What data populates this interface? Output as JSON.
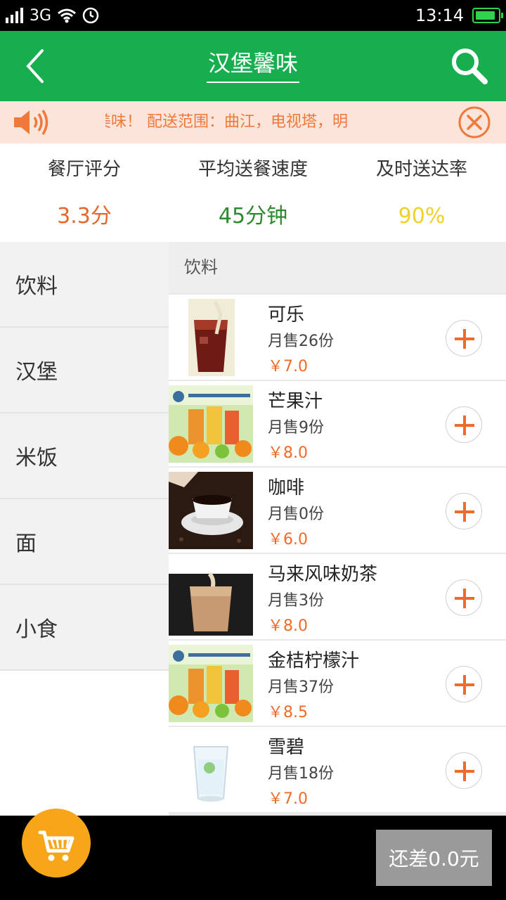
{
  "status_bar": {
    "network": "3G",
    "time": "13:14",
    "battery_level": 0.85
  },
  "header": {
    "title": "汉堡馨味",
    "back_icon": "chevron-left-icon",
    "search_icon": "search-icon"
  },
  "notice": {
    "text": "美味！ 配送范围：曲江，电视塔，明",
    "speaker_icon": "speaker-icon",
    "close_icon": "close-circle-icon"
  },
  "stats": [
    {
      "label": "餐厅评分",
      "value": "3.3分",
      "color": "#e8662a"
    },
    {
      "label": "平均送餐速度",
      "value": "45分钟",
      "color": "#2d8a2d"
    },
    {
      "label": "及时送达率",
      "value": "90%",
      "color": "#f0d02a"
    }
  ],
  "categories": [
    "饮料",
    "汉堡",
    "米饭",
    "面",
    "小食"
  ],
  "section_title": "饮料",
  "products": [
    {
      "name": "可乐",
      "sales": "月售26份",
      "price": "￥7.0",
      "image": "cola-image"
    },
    {
      "name": "芒果汁",
      "sales": "月售9份",
      "price": "￥8.0",
      "image": "juice-image"
    },
    {
      "name": "咖啡",
      "sales": "月售0份",
      "price": "￥6.0",
      "image": "coffee-image"
    },
    {
      "name": "马来风味奶茶",
      "sales": "月售3份",
      "price": "￥8.0",
      "image": "milk-tea-image"
    },
    {
      "name": "金桔柠檬汁",
      "sales": "月售37份",
      "price": "￥8.5",
      "image": "juice-image"
    },
    {
      "name": "雪碧",
      "sales": "月售18份",
      "price": "￥7.0",
      "image": "sprite-glass-image"
    }
  ],
  "footer": {
    "cart_icon": "cart-icon",
    "submit_label": "还差0.0元"
  },
  "colors": {
    "brand_green": "#16ae4e",
    "accent_orange": "#f06a28",
    "cart_yellow": "#f7a519"
  }
}
